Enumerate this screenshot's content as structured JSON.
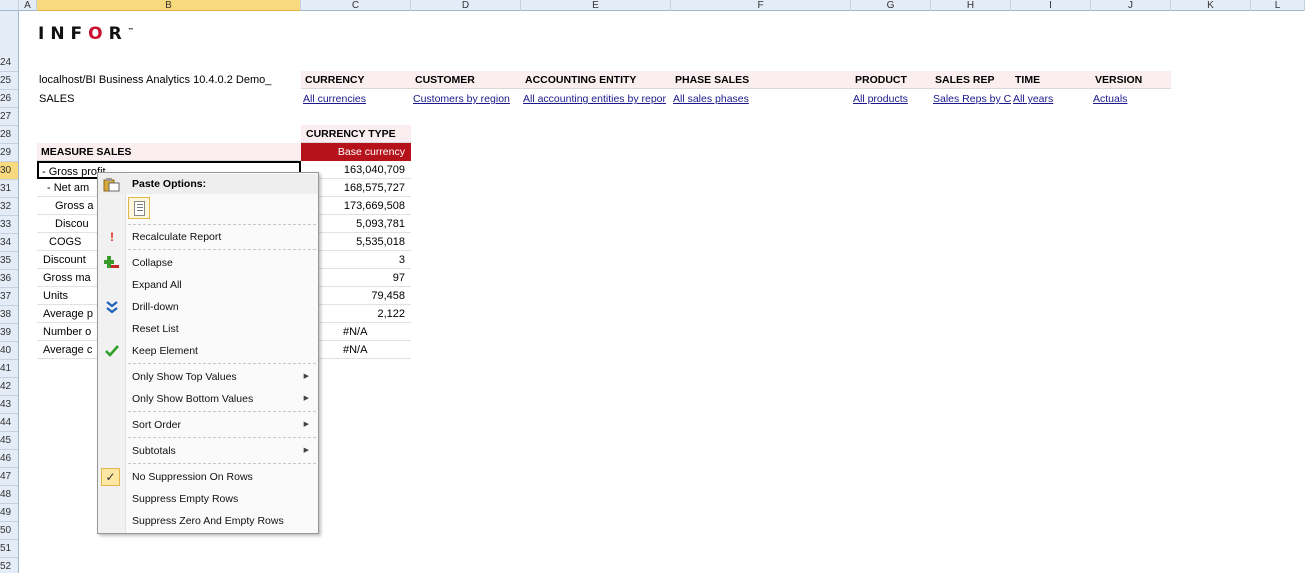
{
  "columns": [
    "A",
    "B",
    "C",
    "D",
    "E",
    "F",
    "G",
    "H",
    "I",
    "J",
    "K",
    "L"
  ],
  "selected_column": "B",
  "rows": [
    "24",
    "25",
    "26",
    "27",
    "28",
    "29",
    "30",
    "31",
    "32",
    "33",
    "34",
    "35",
    "36",
    "37",
    "38",
    "39",
    "40",
    "41",
    "42",
    "43",
    "44",
    "45",
    "46",
    "47",
    "48",
    "49",
    "50",
    "51",
    "52"
  ],
  "selected_row": "30",
  "logo": {
    "before": "INF",
    "o": "O",
    "after": "R",
    "tm": "™"
  },
  "report": {
    "server": "localhost/BI Business Analytics 10.4.0.2 Demo_",
    "cube": "SALES"
  },
  "dimensions": [
    {
      "header": "CURRENCY",
      "value": "All currencies"
    },
    {
      "header": "CUSTOMER",
      "value": "Customers by region"
    },
    {
      "header": "ACCOUNTING ENTITY",
      "value": "All accounting entities by repor"
    },
    {
      "header": "PHASE SALES",
      "value": "All sales phases"
    },
    {
      "header": "PRODUCT",
      "value": "All products"
    },
    {
      "header": "SALES REP",
      "value": "Sales Reps by C"
    },
    {
      "header": "TIME",
      "value": "All years"
    },
    {
      "header": "VERSION",
      "value": "Actuals"
    }
  ],
  "grid": {
    "currency_type_header": "CURRENCY TYPE",
    "measure_header": "MEASURE SALES",
    "currency_type_value": "Base currency",
    "rows": [
      {
        "label": " - Gross profit",
        "value": "163,040,709"
      },
      {
        "label": "  - Net am",
        "value": "168,575,727"
      },
      {
        "label": "     Gross a",
        "value": "173,669,508"
      },
      {
        "label": "     Discou",
        "value": "5,093,781"
      },
      {
        "label": "   COGS",
        "value": "5,535,018"
      },
      {
        "label": " Discount",
        "value": "3"
      },
      {
        "label": " Gross ma",
        "value": "97"
      },
      {
        "label": " Units",
        "value": "79,458"
      },
      {
        "label": " Average p",
        "value": "2,122"
      },
      {
        "label": " Number o",
        "value": "#N/A"
      },
      {
        "label": " Average c",
        "value": "#N/A"
      }
    ]
  },
  "context_menu": {
    "title": "Paste Options:",
    "items": [
      {
        "label": "Recalculate Report",
        "icon": "exclamation-icon"
      },
      {
        "label": "Collapse",
        "icon": "collapse-icon"
      },
      {
        "label": "Expand All",
        "icon": ""
      },
      {
        "label": "Drill-down",
        "icon": "double-chevron-down-icon"
      },
      {
        "label": "Reset List",
        "icon": ""
      },
      {
        "label": "Keep Element",
        "icon": "checkmark-icon"
      },
      {
        "label": "Only Show Top Values",
        "icon": "",
        "submenu": true
      },
      {
        "label": "Only Show Bottom Values",
        "icon": "",
        "submenu": true
      },
      {
        "label": "Sort Order",
        "icon": "",
        "submenu": true
      },
      {
        "label": "Subtotals",
        "icon": "",
        "submenu": true
      },
      {
        "label": "No Suppression On Rows",
        "icon": "checked-box-icon"
      },
      {
        "label": "Suppress Empty Rows",
        "icon": ""
      },
      {
        "label": "Suppress Zero And Empty Rows",
        "icon": ""
      }
    ]
  },
  "colors": {
    "accent_red": "#b5121b",
    "header_pink": "#fbeef0",
    "link_blue": "#1a1a8c"
  }
}
